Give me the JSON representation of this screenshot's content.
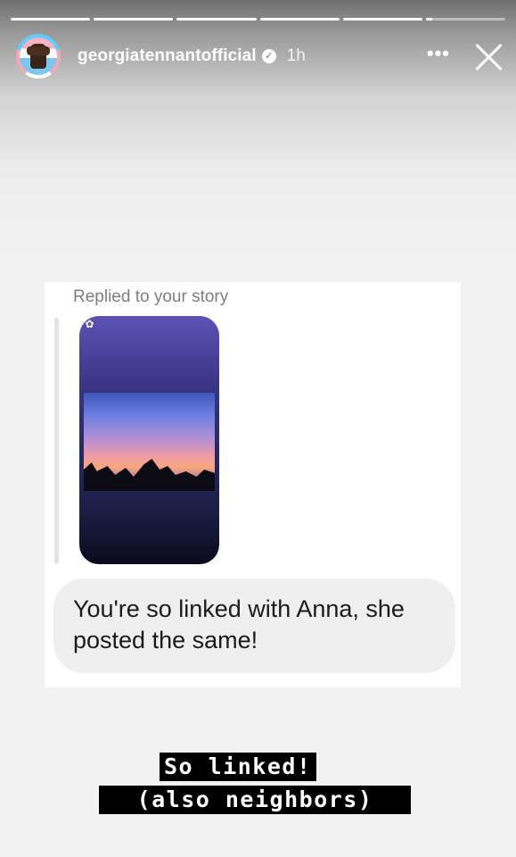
{
  "story": {
    "progress_segments": 6,
    "current_segment_fraction": 0.08
  },
  "header": {
    "username": "georgiatennantofficial",
    "time": "1h",
    "more_icon": "ellipsis-icon",
    "close_icon": "close-icon",
    "verified_icon": "verified-badge-icon"
  },
  "reply_card": {
    "replied_label": "Replied to your story",
    "message": "You're so linked with Anna, she posted the same!"
  },
  "captions": {
    "line1": "So linked!",
    "line2": "(also neighbors)"
  }
}
